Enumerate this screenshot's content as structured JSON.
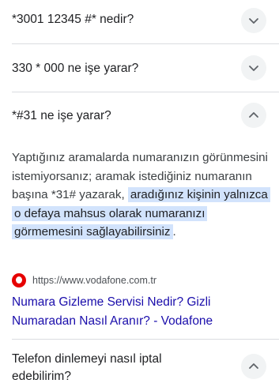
{
  "faq": {
    "items": [
      {
        "question": "*3001 12345 #* nedir?",
        "expanded": false
      },
      {
        "question": "330 * 000 ne işe yarar?",
        "expanded": false
      },
      {
        "question": "*#31 ne işe yarar?",
        "expanded": true
      },
      {
        "question": "Telefon dinlemeyi nasıl iptal edebilirim?",
        "expanded": false
      }
    ],
    "answer": {
      "text_plain": "Yaptığınız aramalarda numaranızın görünmesini istemiyorsanız; aramak istediğiniz numaranın başına *31# yazarak,",
      "text_highlight": "aradığınız kişinin yalnızca o defaya mahsus olarak numaranızı görmemesini sağlayabilirsiniz",
      "text_end": "."
    },
    "source": {
      "icon": "vodafone-logo-icon",
      "url": "https://www.vodafone.com.tr",
      "title": "Numara Gizleme Servisi Nedir? Gizli Numaradan Nasıl Aranır? - Vodafone"
    }
  },
  "colors": {
    "link": "#1a0dab",
    "highlight": "#d2e3fc",
    "divider": "#dadce0",
    "chevron_bg": "#f1f3f4",
    "brand": "#e60000"
  }
}
